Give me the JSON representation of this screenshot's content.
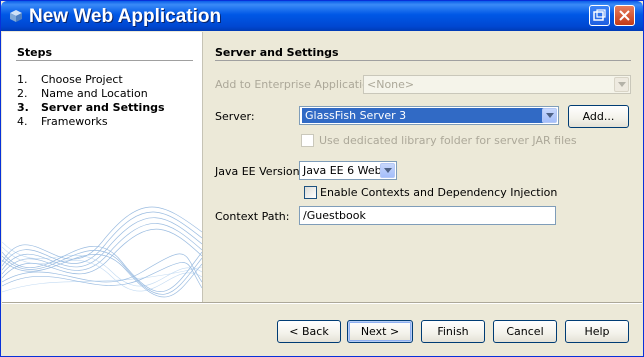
{
  "window": {
    "title": "New Web Application"
  },
  "steps": {
    "title": "Steps",
    "items": [
      {
        "num": "1.",
        "label": "Choose Project"
      },
      {
        "num": "2.",
        "label": "Name and Location"
      },
      {
        "num": "3.",
        "label": "Server and Settings",
        "current": true
      },
      {
        "num": "4.",
        "label": "Frameworks"
      }
    ]
  },
  "form": {
    "section_title": "Server and Settings",
    "enterprise_label": "Add to Enterprise Application:",
    "enterprise_value": "<None>",
    "server_label": "Server:",
    "server_value": "GlassFish Server 3",
    "add_button": "Add...",
    "dedicated_folder_label": "Use dedicated library folder for server JAR files",
    "dedicated_folder_checked": false,
    "javaee_label": "Java EE Version:",
    "javaee_value": "Java EE 6 Web",
    "cdi_label": "Enable Contexts and Dependency Injection",
    "cdi_checked": false,
    "context_path_label": "Context Path:",
    "context_path_value": "/Guestbook"
  },
  "buttons": {
    "back": "< Back",
    "next": "Next >",
    "finish": "Finish",
    "cancel": "Cancel",
    "help": "Help"
  }
}
